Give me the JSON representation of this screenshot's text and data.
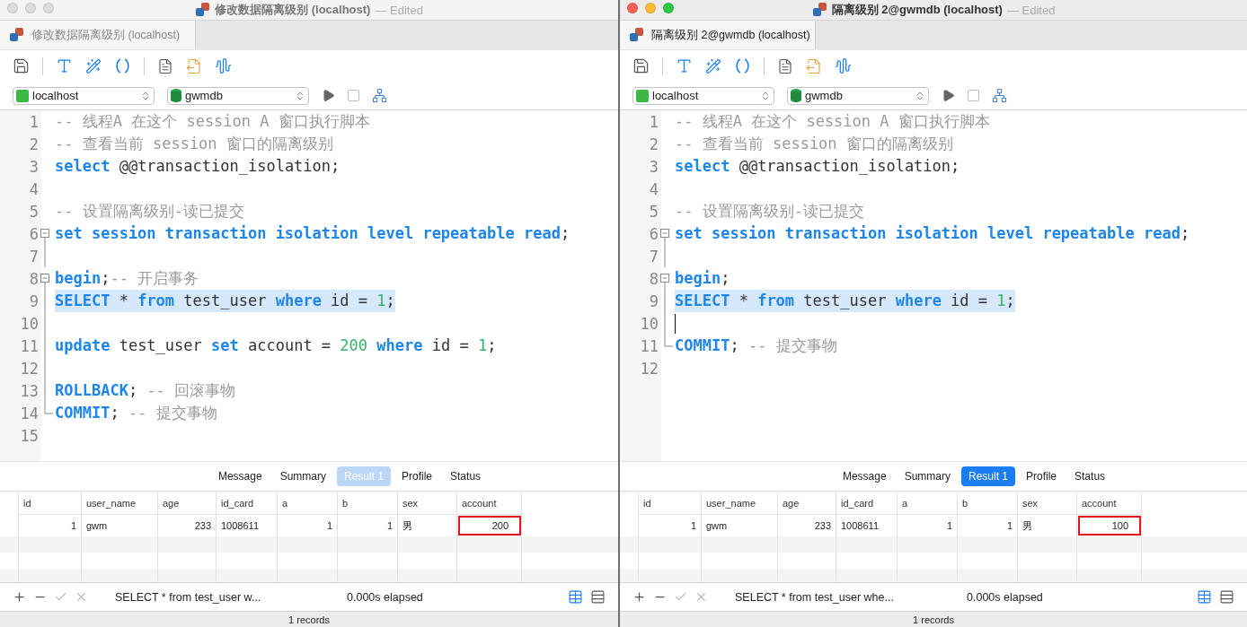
{
  "windows": [
    {
      "title": "修改数据隔离级别 (localhost)",
      "title_suffix": "— Edited",
      "active": false,
      "tab": "修改数据隔离级别 (localhost)",
      "connection": "localhost",
      "database": "gwmdb",
      "checkbox": {
        "checked": false
      },
      "code": [
        {
          "n": "1",
          "highlighted": false,
          "cursor": false,
          "tokens": [
            {
              "t": "-- 线程A 在这个 session A 窗口执行脚本",
              "kind": "comment"
            }
          ]
        },
        {
          "n": "2",
          "highlighted": false,
          "cursor": false,
          "tokens": [
            {
              "t": "-- 查看当前 session 窗口的隔离级别",
              "kind": "comment"
            }
          ]
        },
        {
          "n": "3",
          "highlighted": false,
          "cursor": false,
          "tokens": [
            {
              "t": "select",
              "kind": "keyword"
            },
            {
              "t": " @@transaction_isolation;",
              "kind": "plain"
            }
          ]
        },
        {
          "n": "4",
          "highlighted": false,
          "cursor": false
        },
        {
          "n": "5",
          "highlighted": false,
          "cursor": false,
          "tokens": [
            {
              "t": "-- 设置隔离级别-读已提交",
              "kind": "comment"
            }
          ]
        },
        {
          "n": "6",
          "fold": {
            "kind": "open"
          },
          "highlighted": false,
          "cursor": false,
          "tokens": [
            {
              "t": "set session transaction isolation level repeatable read",
              "kind": "keyword"
            },
            {
              "t": ";",
              "kind": "plain"
            }
          ]
        },
        {
          "n": "7",
          "fold": {
            "kind": "line"
          },
          "highlighted": false,
          "cursor": false
        },
        {
          "n": "8",
          "fold": {
            "kind": "open"
          },
          "highlighted": false,
          "cursor": false,
          "tokens": [
            {
              "t": "begin",
              "kind": "keyword"
            },
            {
              "t": ";",
              "kind": "plain"
            },
            {
              "t": "-- 开启事务",
              "kind": "comment"
            }
          ]
        },
        {
          "n": "9",
          "fold": {
            "kind": "line"
          },
          "highlighted": true,
          "cursor": false,
          "tokens": [
            {
              "t": "SELECT",
              "kind": "keyword"
            },
            {
              "t": " * ",
              "kind": "plain"
            },
            {
              "t": "from",
              "kind": "keyword"
            },
            {
              "t": " test_user ",
              "kind": "plain"
            },
            {
              "t": "where",
              "kind": "keyword"
            },
            {
              "t": " id = ",
              "kind": "plain"
            },
            {
              "t": "1",
              "kind": "number"
            },
            {
              "t": ";",
              "kind": "plain"
            }
          ]
        },
        {
          "n": "10",
          "fold": {
            "kind": "line"
          },
          "highlighted": false,
          "cursor": false
        },
        {
          "n": "11",
          "fold": {
            "kind": "line"
          },
          "highlighted": false,
          "cursor": false,
          "tokens": [
            {
              "t": "update",
              "kind": "keyword"
            },
            {
              "t": " test_user ",
              "kind": "plain"
            },
            {
              "t": "set",
              "kind": "keyword"
            },
            {
              "t": " account = ",
              "kind": "plain"
            },
            {
              "t": "200",
              "kind": "number"
            },
            {
              "t": " where",
              "kind": "keyword"
            },
            {
              "t": " id = ",
              "kind": "plain"
            },
            {
              "t": "1",
              "kind": "number"
            },
            {
              "t": ";",
              "kind": "plain"
            }
          ]
        },
        {
          "n": "12",
          "fold": {
            "kind": "line"
          },
          "highlighted": false,
          "cursor": false
        },
        {
          "n": "13",
          "fold": {
            "kind": "line"
          },
          "highlighted": false,
          "cursor": false,
          "tokens": [
            {
              "t": "ROLLBACK",
              "kind": "keyword"
            },
            {
              "t": "; ",
              "kind": "plain"
            },
            {
              "t": "-- 回滚事物",
              "kind": "comment"
            }
          ]
        },
        {
          "n": "14",
          "fold": {
            "kind": "end"
          },
          "highlighted": false,
          "cursor": false,
          "tokens": [
            {
              "t": "COMMIT",
              "kind": "keyword"
            },
            {
              "t": "; ",
              "kind": "plain"
            },
            {
              "t": "-- 提交事物",
              "kind": "comment"
            }
          ]
        },
        {
          "n": "15",
          "highlighted": false,
          "cursor": false
        }
      ],
      "result_tabs": [
        {
          "label": "Message",
          "selected": false
        },
        {
          "label": "Summary",
          "selected": false
        },
        {
          "label": "Result 1",
          "selected": true
        },
        {
          "label": "Profile",
          "selected": false
        },
        {
          "label": "Status",
          "selected": false
        }
      ],
      "columns": [
        {
          "label": "id",
          "numeric": true
        },
        {
          "label": "user_name",
          "numeric": false
        },
        {
          "label": "age",
          "numeric": true
        },
        {
          "label": "id_card",
          "numeric": false
        },
        {
          "label": "a",
          "numeric": true
        },
        {
          "label": "b",
          "numeric": true
        },
        {
          "label": "sex",
          "numeric": false
        },
        {
          "label": "account",
          "numeric": true
        }
      ],
      "rows": [
        {
          "cells": [
            {
              "text": "1",
              "marked": false
            },
            {
              "text": "gwm",
              "marked": false
            },
            {
              "text": "233",
              "marked": false
            },
            {
              "text": "1008611",
              "marked": false
            },
            {
              "text": "1",
              "marked": false
            },
            {
              "text": "1",
              "marked": false
            },
            {
              "text": "男",
              "marked": false
            },
            {
              "text": "200",
              "marked": true
            }
          ]
        }
      ],
      "status": {
        "query": "SELECT * from test_user w...",
        "elapsed": "0.000s elapsed",
        "records": "1 records"
      }
    },
    {
      "title": "隔离级别 2@gwmdb (localhost)",
      "title_suffix": "— Edited",
      "active": true,
      "tab": "隔离级别 2@gwmdb (localhost)",
      "connection": "localhost",
      "database": "gwmdb",
      "checkbox": {
        "checked": false
      },
      "code": [
        {
          "n": "1",
          "highlighted": false,
          "cursor": false,
          "tokens": [
            {
              "t": "-- 线程A 在这个 session A 窗口执行脚本",
              "kind": "comment"
            }
          ]
        },
        {
          "n": "2",
          "highlighted": false,
          "cursor": false,
          "tokens": [
            {
              "t": "-- 查看当前 session 窗口的隔离级别",
              "kind": "comment"
            }
          ]
        },
        {
          "n": "3",
          "highlighted": false,
          "cursor": false,
          "tokens": [
            {
              "t": "select",
              "kind": "keyword"
            },
            {
              "t": " @@transaction_isolation;",
              "kind": "plain"
            }
          ]
        },
        {
          "n": "4",
          "highlighted": false,
          "cursor": false
        },
        {
          "n": "5",
          "highlighted": false,
          "cursor": false,
          "tokens": [
            {
              "t": "-- 设置隔离级别-读已提交",
              "kind": "comment"
            }
          ]
        },
        {
          "n": "6",
          "fold": {
            "kind": "open"
          },
          "highlighted": false,
          "cursor": false,
          "tokens": [
            {
              "t": "set session transaction isolation level repeatable read",
              "kind": "keyword"
            },
            {
              "t": ";",
              "kind": "plain"
            }
          ]
        },
        {
          "n": "7",
          "fold": {
            "kind": "line"
          },
          "highlighted": false,
          "cursor": false
        },
        {
          "n": "8",
          "fold": {
            "kind": "open"
          },
          "highlighted": false,
          "cursor": false,
          "tokens": [
            {
              "t": "begin",
              "kind": "keyword"
            },
            {
              "t": ";",
              "kind": "plain"
            }
          ]
        },
        {
          "n": "9",
          "fold": {
            "kind": "line"
          },
          "highlighted": true,
          "cursor": false,
          "tokens": [
            {
              "t": "SELECT",
              "kind": "keyword"
            },
            {
              "t": " * ",
              "kind": "plain"
            },
            {
              "t": "from",
              "kind": "keyword"
            },
            {
              "t": " test_user ",
              "kind": "plain"
            },
            {
              "t": "where",
              "kind": "keyword"
            },
            {
              "t": " id = ",
              "kind": "plain"
            },
            {
              "t": "1",
              "kind": "number"
            },
            {
              "t": ";",
              "kind": "plain"
            }
          ]
        },
        {
          "n": "10",
          "fold": {
            "kind": "line"
          },
          "highlighted": false,
          "cursor": true
        },
        {
          "n": "11",
          "fold": {
            "kind": "end"
          },
          "highlighted": false,
          "cursor": false,
          "tokens": [
            {
              "t": "COMMIT",
              "kind": "keyword"
            },
            {
              "t": "; ",
              "kind": "plain"
            },
            {
              "t": "-- 提交事物",
              "kind": "comment"
            }
          ]
        },
        {
          "n": "12",
          "highlighted": false,
          "cursor": false
        }
      ],
      "result_tabs": [
        {
          "label": "Message",
          "selected": false
        },
        {
          "label": "Summary",
          "selected": false
        },
        {
          "label": "Result 1",
          "selected": true
        },
        {
          "label": "Profile",
          "selected": false
        },
        {
          "label": "Status",
          "selected": false
        }
      ],
      "columns": [
        {
          "label": "id",
          "numeric": true
        },
        {
          "label": "user_name",
          "numeric": false
        },
        {
          "label": "age",
          "numeric": true
        },
        {
          "label": "id_card",
          "numeric": false
        },
        {
          "label": "a",
          "numeric": true
        },
        {
          "label": "b",
          "numeric": true
        },
        {
          "label": "sex",
          "numeric": false
        },
        {
          "label": "account",
          "numeric": true
        }
      ],
      "rows": [
        {
          "cells": [
            {
              "text": "1",
              "marked": false
            },
            {
              "text": "gwm",
              "marked": false
            },
            {
              "text": "233",
              "marked": false
            },
            {
              "text": "1008611",
              "marked": false
            },
            {
              "text": "1",
              "marked": false
            },
            {
              "text": "1",
              "marked": false
            },
            {
              "text": "男",
              "marked": false
            },
            {
              "text": "100",
              "marked": true
            }
          ]
        }
      ],
      "status": {
        "query": "SELECT * from test_user whe...",
        "elapsed": "0.000s elapsed",
        "records": "1 records"
      }
    }
  ]
}
